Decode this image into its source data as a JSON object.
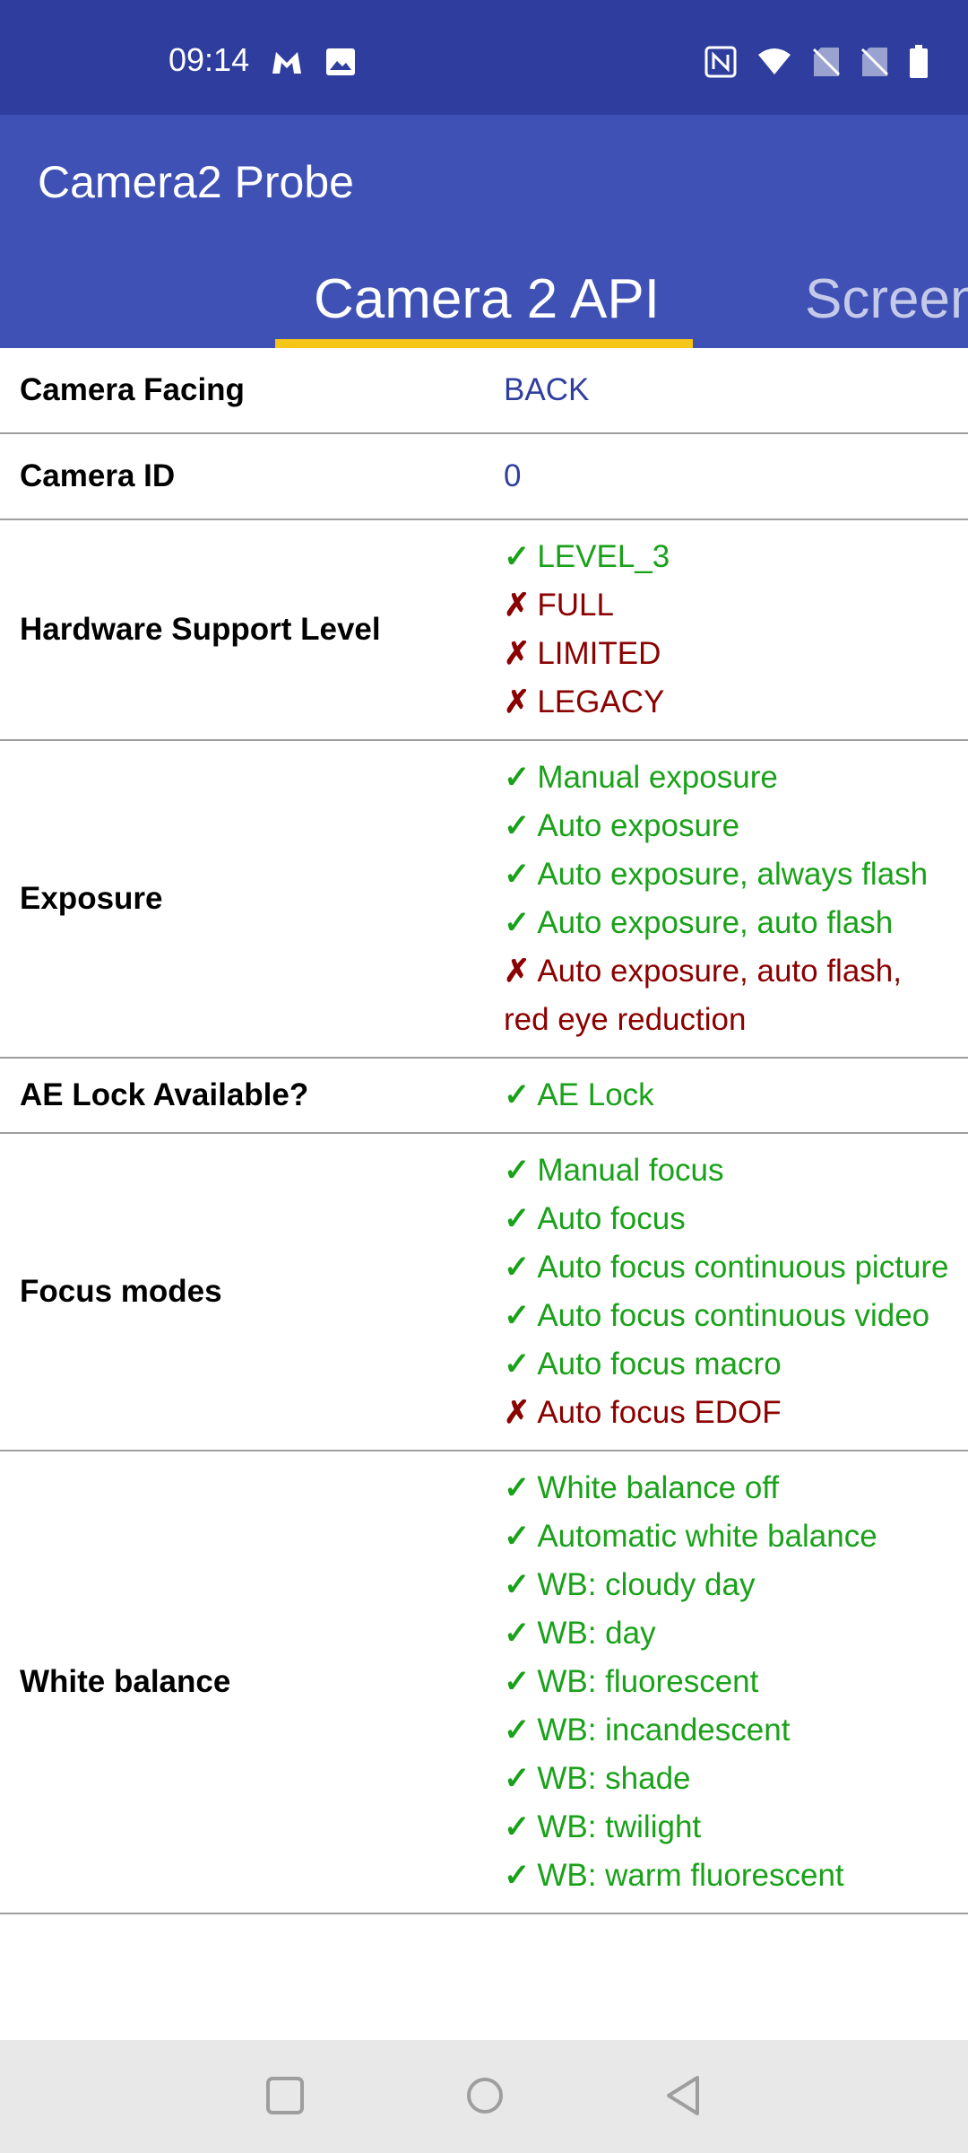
{
  "status_bar": {
    "time": "09:14",
    "left_icons": [
      "malwarebytes-icon",
      "image-icon"
    ],
    "right_icons": [
      "nfc-icon",
      "wifi-icon",
      "no-sim-icon",
      "no-sim-icon",
      "battery-icon"
    ]
  },
  "app_bar": {
    "title": "Camera2 Probe"
  },
  "tabs": [
    {
      "label": "Camera 2 API",
      "active": true
    },
    {
      "label": "Screen",
      "active": false
    }
  ],
  "rows": [
    {
      "label": "Camera Facing",
      "value": "BACK"
    },
    {
      "label": "Camera ID",
      "value": "0"
    },
    {
      "label": "Hardware Support Level",
      "items": [
        {
          "ok": true,
          "text": "LEVEL_3"
        },
        {
          "ok": false,
          "text": "FULL"
        },
        {
          "ok": false,
          "text": "LIMITED"
        },
        {
          "ok": false,
          "text": "LEGACY"
        }
      ]
    },
    {
      "label": "Exposure",
      "items": [
        {
          "ok": true,
          "text": "Manual exposure"
        },
        {
          "ok": true,
          "text": "Auto exposure"
        },
        {
          "ok": true,
          "text": "Auto exposure, always flash"
        },
        {
          "ok": true,
          "text": "Auto exposure, auto flash"
        },
        {
          "ok": false,
          "text": "Auto exposure, auto flash, red eye reduction"
        }
      ]
    },
    {
      "label": "AE Lock Available?",
      "items": [
        {
          "ok": true,
          "text": "AE Lock"
        }
      ]
    },
    {
      "label": "Focus modes",
      "items": [
        {
          "ok": true,
          "text": "Manual focus"
        },
        {
          "ok": true,
          "text": "Auto focus"
        },
        {
          "ok": true,
          "text": "Auto focus continuous picture"
        },
        {
          "ok": true,
          "text": "Auto focus continuous video"
        },
        {
          "ok": true,
          "text": "Auto focus macro"
        },
        {
          "ok": false,
          "text": "Auto focus EDOF"
        }
      ]
    },
    {
      "label": "White balance",
      "items": [
        {
          "ok": true,
          "text": "White balance off"
        },
        {
          "ok": true,
          "text": "Automatic white balance"
        },
        {
          "ok": true,
          "text": "WB: cloudy day"
        },
        {
          "ok": true,
          "text": "WB: day"
        },
        {
          "ok": true,
          "text": "WB: fluorescent"
        },
        {
          "ok": true,
          "text": "WB: incandescent"
        },
        {
          "ok": true,
          "text": "WB: shade"
        },
        {
          "ok": true,
          "text": "WB: twilight"
        },
        {
          "ok": true,
          "text": "WB: warm fluorescent"
        }
      ]
    }
  ],
  "marks": {
    "yes": "✓",
    "no": "✗"
  },
  "colors": {
    "status_bar": "#2f3e9e",
    "app_bar": "#3f51b5",
    "tab_indicator": "#f5c518",
    "supported": "#1aa11a",
    "unsupported": "#8b0000",
    "value": "#303f9f"
  },
  "nav_bar": {
    "buttons": [
      "recents-button",
      "home-button",
      "back-button"
    ]
  }
}
